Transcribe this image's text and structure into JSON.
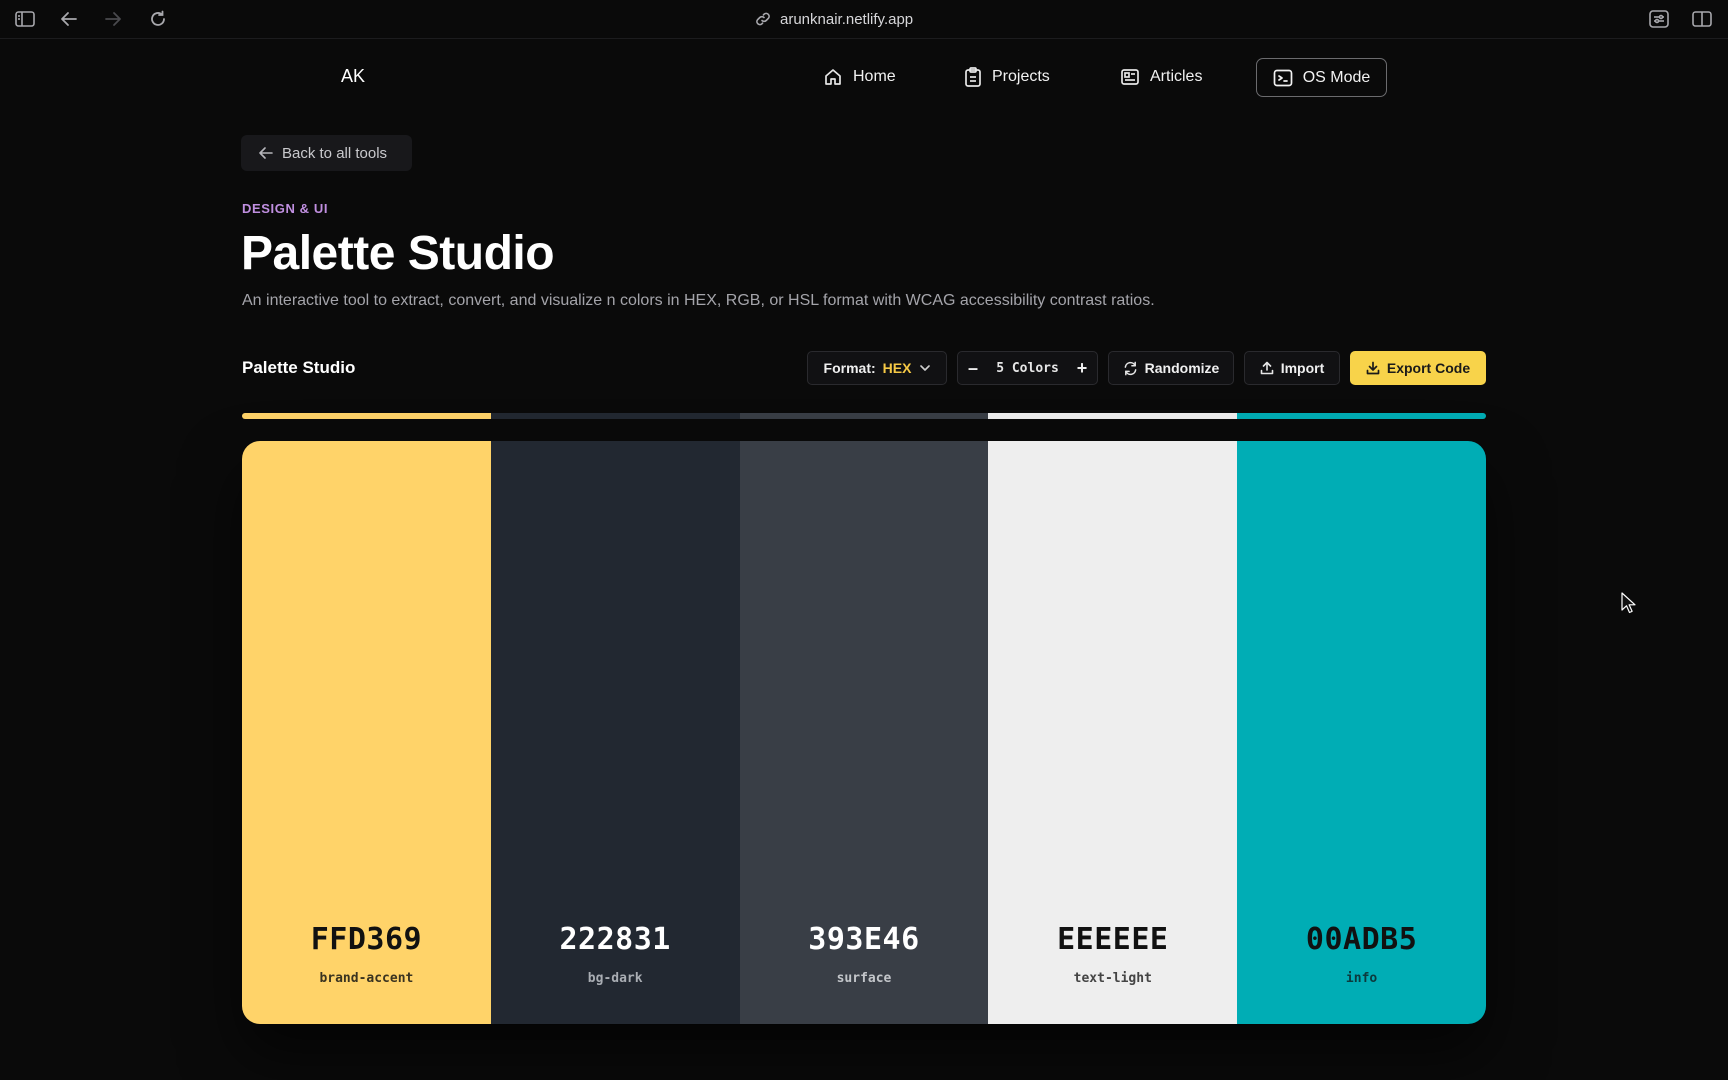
{
  "browser": {
    "url": "arunknair.netlify.app"
  },
  "site": {
    "logo": "AK",
    "nav": [
      {
        "label": "Home",
        "icon": "home-icon"
      },
      {
        "label": "Projects",
        "icon": "clipboard-icon"
      },
      {
        "label": "Articles",
        "icon": "newspaper-icon"
      },
      {
        "label": "OS Mode",
        "icon": "terminal-icon"
      }
    ]
  },
  "page": {
    "back_label": "Back to all tools",
    "category": "DESIGN & UI",
    "title": "Palette Studio",
    "description": "An interactive tool to extract, convert, and visualize n colors in HEX, RGB, or HSL format with WCAG accessibility contrast ratios."
  },
  "tool": {
    "title": "Palette Studio",
    "format_label": "Format:",
    "format_value": "HEX",
    "color_count": "5 Colors",
    "decrement_label": "–",
    "increment_label": "+",
    "randomize_label": "Randomize",
    "import_label": "Import",
    "export_label": "Export Code"
  },
  "colors": {
    "accent_yellow": "#F8D34A",
    "format_value_color": "#F6C945",
    "category_color": "#C08FE0"
  },
  "swatches": [
    {
      "hex": "FFD369",
      "name": "brand-accent",
      "color": "#FFD369",
      "text_color": "#111111",
      "name_color": "#3a3320"
    },
    {
      "hex": "222831",
      "name": "bg-dark",
      "color": "#222831",
      "text_color": "#FFFFFF",
      "name_color": "#a9adb3"
    },
    {
      "hex": "393E46",
      "name": "surface",
      "color": "#393E46",
      "text_color": "#FFFFFF",
      "name_color": "#c3c6ca"
    },
    {
      "hex": "EEEEEE",
      "name": "text-light",
      "color": "#EEEEEE",
      "text_color": "#111111",
      "name_color": "#444444"
    },
    {
      "hex": "00ADB5",
      "name": "info",
      "color": "#00ADB5",
      "text_color": "#111111",
      "name_color": "#0c3a3d"
    }
  ]
}
